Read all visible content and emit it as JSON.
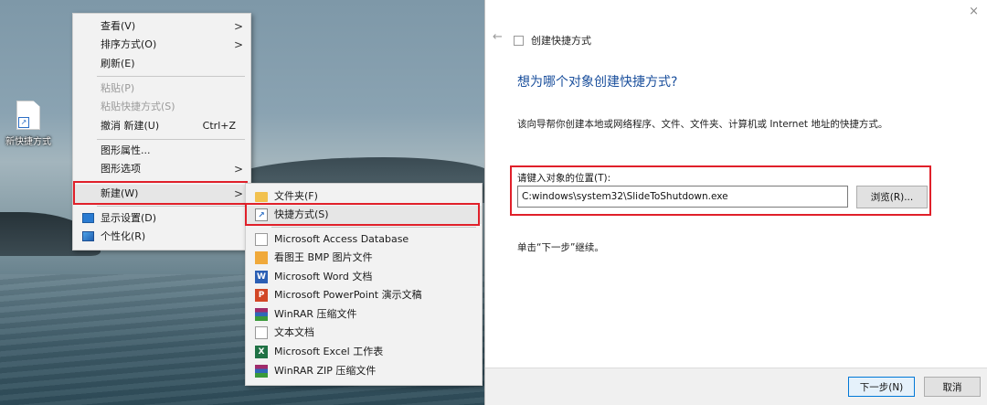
{
  "desktop": {
    "shortcut_icon_label": "新快捷方式"
  },
  "context_menu": {
    "items": [
      {
        "label": "查看(V)",
        "submenu": true
      },
      {
        "label": "排序方式(O)",
        "submenu": true
      },
      {
        "label": "刷新(E)"
      },
      {
        "label": "粘贴(P)",
        "disabled": true
      },
      {
        "label": "粘贴快捷方式(S)",
        "disabled": true
      },
      {
        "label": "撤消 新建(U)",
        "shortcut": "Ctrl+Z"
      },
      {
        "label": "图形属性..."
      },
      {
        "label": "图形选项",
        "submenu": true
      },
      {
        "label": "新建(W)",
        "submenu": true,
        "highlighted": true
      },
      {
        "label": "显示设置(D)",
        "icon": "monitor-icon"
      },
      {
        "label": "个性化(R)",
        "icon": "personalize-icon"
      }
    ],
    "chevron": ">"
  },
  "new_submenu": {
    "items": [
      {
        "label": "文件夹(F)",
        "icon": "folder-icon"
      },
      {
        "label": "快捷方式(S)",
        "icon": "shortcut-icon",
        "highlighted": true
      },
      {
        "label": "Microsoft Access Database",
        "icon": "document-icon"
      },
      {
        "label": "看图王 BMP 图片文件",
        "icon": "bmp-image-icon"
      },
      {
        "label": "Microsoft Word 文档",
        "icon": "word-icon"
      },
      {
        "label": "Microsoft PowerPoint 演示文稿",
        "icon": "powerpoint-icon"
      },
      {
        "label": "WinRAR 压缩文件",
        "icon": "winrar-icon"
      },
      {
        "label": "文本文档",
        "icon": "text-document-icon"
      },
      {
        "label": "Microsoft Excel 工作表",
        "icon": "excel-icon"
      },
      {
        "label": "WinRAR ZIP 压缩文件",
        "icon": "winrar-zip-icon"
      }
    ]
  },
  "dialog": {
    "title": "创建快捷方式",
    "heading": "想为哪个对象创建快捷方式?",
    "description": "该向导帮你创建本地或网络程序、文件、文件夹、计算机或 Internet 地址的快捷方式。",
    "input_label": "请键入对象的位置(T):",
    "input_value": "C:windows\\system32\\SlideToShutdown.exe",
    "browse_label": "浏览(R)...",
    "hint": "单击“下一步”继续。",
    "next_label": "下一步(N)",
    "cancel_label": "取消",
    "close_glyph": "×",
    "back_glyph": "←"
  },
  "colors": {
    "highlight_border": "#e0202a",
    "heading_blue": "#1a4f9c",
    "primary_button_border": "#0078d7"
  }
}
